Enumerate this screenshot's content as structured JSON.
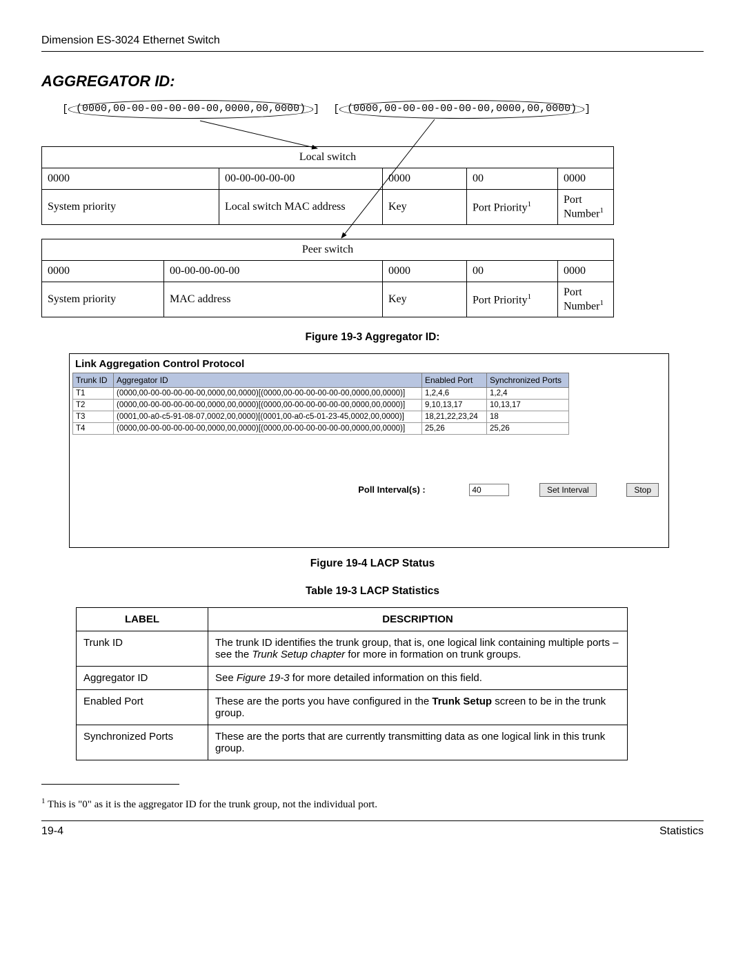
{
  "header": {
    "title": "Dimension ES-3024 Ethernet Switch"
  },
  "section_title": "AGGREGATOR ID:",
  "agg_examples": {
    "left_prefix": "[",
    "left_ellipse": "(0000,00-00-00-00-00-00,0000,00,0000)",
    "left_suffix": "]",
    "right_prefix": "[",
    "right_ellipse": "(0000,00-00-00-00-00-00,0000,00,0000)",
    "right_suffix": "]"
  },
  "local_switch": {
    "title": "Local switch",
    "vals": [
      "0000",
      "00-00-00-00-00",
      "0000",
      "00",
      "0000"
    ],
    "labels": [
      "System priority",
      "Local switch MAC address",
      "Key",
      "Port Priority",
      "Port Number"
    ],
    "sup": [
      "",
      "",
      "",
      "1",
      "1"
    ]
  },
  "peer_switch": {
    "title": "Peer switch",
    "vals": [
      "0000",
      "00-00-00-00-00",
      "0000",
      "00",
      "0000"
    ],
    "labels": [
      "System priority",
      "MAC address",
      "Key",
      "Port Priority",
      "Port Number"
    ],
    "sup": [
      "",
      "",
      "",
      "1",
      "1"
    ]
  },
  "fig1_caption": "Figure 19-3 Aggregator ID:",
  "lacp": {
    "title": "Link Aggregation Control Protocol",
    "cols": [
      "Trunk ID",
      "Aggregator ID",
      "Enabled Port",
      "Synchronized Ports"
    ],
    "rows": [
      {
        "t": "T1",
        "a": "(0000,00-00-00-00-00-00,0000,00,0000)[(0000,00-00-00-00-00-00,0000,00,0000)]",
        "e": "1,2,4,6",
        "s": "1,2,4"
      },
      {
        "t": "T2",
        "a": "(0000,00-00-00-00-00-00,0000,00,0000)[(0000,00-00-00-00-00-00,0000,00,0000)]",
        "e": "9,10,13,17",
        "s": "10,13,17"
      },
      {
        "t": "T3",
        "a": "(0001,00-a0-c5-91-08-07,0002,00,0000)[(0001,00-a0-c5-01-23-45,0002,00,0000)]",
        "e": "18,21,22,23,24",
        "s": "18"
      },
      {
        "t": "T4",
        "a": "(0000,00-00-00-00-00-00,0000,00,0000)[(0000,00-00-00-00-00-00,0000,00,0000)]",
        "e": "25,26",
        "s": "25,26"
      }
    ],
    "poll_label": "Poll Interval(s) :",
    "poll_value": "40",
    "btn_set": "Set Interval",
    "btn_stop": "Stop"
  },
  "fig2_caption": "Figure 19-4 LACP Status",
  "table_caption": "Table 19-3 LACP Statistics",
  "stats": {
    "head": [
      "LABEL",
      "DESCRIPTION"
    ],
    "rows": [
      {
        "l": "Trunk ID",
        "d_pre": "The trunk ID identifies the trunk group, that is, one logical link containing multiple ports – see the ",
        "d_em": "Trunk Setup chapter",
        "d_post": " for more in formation on trunk groups."
      },
      {
        "l": "Aggregator ID",
        "d_pre": "See ",
        "d_em": "Figure 19-3",
        "d_post": " for more detailed information on this field."
      },
      {
        "l": "Enabled Port",
        "d_pre": "These are the ports you have configured in the ",
        "d_strong": "Trunk Setup",
        "d_post": " screen to be in the trunk group."
      },
      {
        "l": "Synchronized Ports",
        "d_pre": "These are the ports that are currently transmitting data as one logical link in this trunk group.",
        "d_post": ""
      }
    ]
  },
  "footnote": "This is \"0\" as it is the aggregator ID for the trunk group, not the individual port.",
  "footnote_sup": "1",
  "footer": {
    "left": "19-4",
    "right": "Statistics"
  }
}
